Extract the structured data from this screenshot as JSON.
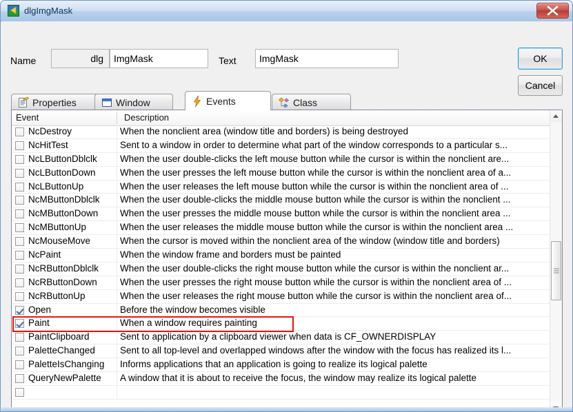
{
  "window": {
    "title": "dlgImgMask",
    "icon": "app-icon",
    "close_label": "Close"
  },
  "fields": {
    "name_label": "Name",
    "name_prefix": "dlg",
    "name_value": "ImgMask",
    "text_label": "Text",
    "text_value": "ImgMask"
  },
  "buttons": {
    "ok": "OK",
    "cancel": "Cancel"
  },
  "tabs": [
    {
      "label": "Properties",
      "icon": "properties-icon",
      "active": false
    },
    {
      "label": "Window",
      "icon": "window-icon",
      "active": false
    },
    {
      "label": "Events",
      "icon": "lightning-icon",
      "active": true
    },
    {
      "label": "Class",
      "icon": "class-icon",
      "active": false
    }
  ],
  "list": {
    "columns": [
      "Event",
      "Description"
    ],
    "rows": [
      {
        "checked": false,
        "name": "NcDestroy",
        "desc": "When the nonclient area (window title and borders) is being destroyed"
      },
      {
        "checked": false,
        "name": "NcHitTest",
        "desc": "Sent to a window in order to determine what part of the window corresponds to a particular s..."
      },
      {
        "checked": false,
        "name": "NcLButtonDblclk",
        "desc": "When the user double-clicks the left mouse button while the cursor is within the nonclient are..."
      },
      {
        "checked": false,
        "name": "NcLButtonDown",
        "desc": "When the user presses the left mouse button while the cursor is within the nonclient area of a..."
      },
      {
        "checked": false,
        "name": "NcLButtonUp",
        "desc": "When the user releases the left mouse button while the cursor is within the nonclient area of ..."
      },
      {
        "checked": false,
        "name": "NcMButtonDblclk",
        "desc": "When the user double-clicks the middle mouse button while the cursor is within the nonclient ..."
      },
      {
        "checked": false,
        "name": "NcMButtonDown",
        "desc": "When the user presses the middle mouse button while the cursor is within the nonclient area ..."
      },
      {
        "checked": false,
        "name": "NcMButtonUp",
        "desc": "When the user releases the middle mouse button while the cursor is within the nonclient area ..."
      },
      {
        "checked": false,
        "name": "NcMouseMove",
        "desc": "When the cursor is moved within the nonclient area of the window (window title and borders)"
      },
      {
        "checked": false,
        "name": "NcPaint",
        "desc": "When the window frame and borders must be painted"
      },
      {
        "checked": false,
        "name": "NcRButtonDblclk",
        "desc": "When the user double-clicks the right mouse button while the cursor is within the nonclient ar..."
      },
      {
        "checked": false,
        "name": "NcRButtonDown",
        "desc": "When the user presses the right mouse button while the cursor is within the nonclient area of ..."
      },
      {
        "checked": false,
        "name": "NcRButtonUp",
        "desc": "When the user releases the right mouse button while the cursor is within the nonclient area of..."
      },
      {
        "checked": true,
        "name": "Open",
        "desc": "Before the window becomes visible"
      },
      {
        "checked": true,
        "name": "Paint",
        "desc": "When a window requires painting",
        "annotated": true
      },
      {
        "checked": false,
        "name": "PaintClipboard",
        "desc": "Sent to application by a clipboard viewer when data is CF_OWNERDISPLAY"
      },
      {
        "checked": false,
        "name": "PaletteChanged",
        "desc": "Sent to all top-level and overlapped windows after the window with the focus has realized its l..."
      },
      {
        "checked": false,
        "name": "PaletteIsChanging",
        "desc": "Informs applications that an application is going to realize its logical palette"
      },
      {
        "checked": false,
        "name": "QueryNewPalette",
        "desc": "A window that it is about to receive the focus, the window may realize its logical palette"
      },
      {
        "checked": false,
        "name": "",
        "desc": ""
      }
    ]
  },
  "colors": {
    "annotation": "#ee1111",
    "accent": "#2e9ad0",
    "titlebar": "#a8c6e6"
  }
}
